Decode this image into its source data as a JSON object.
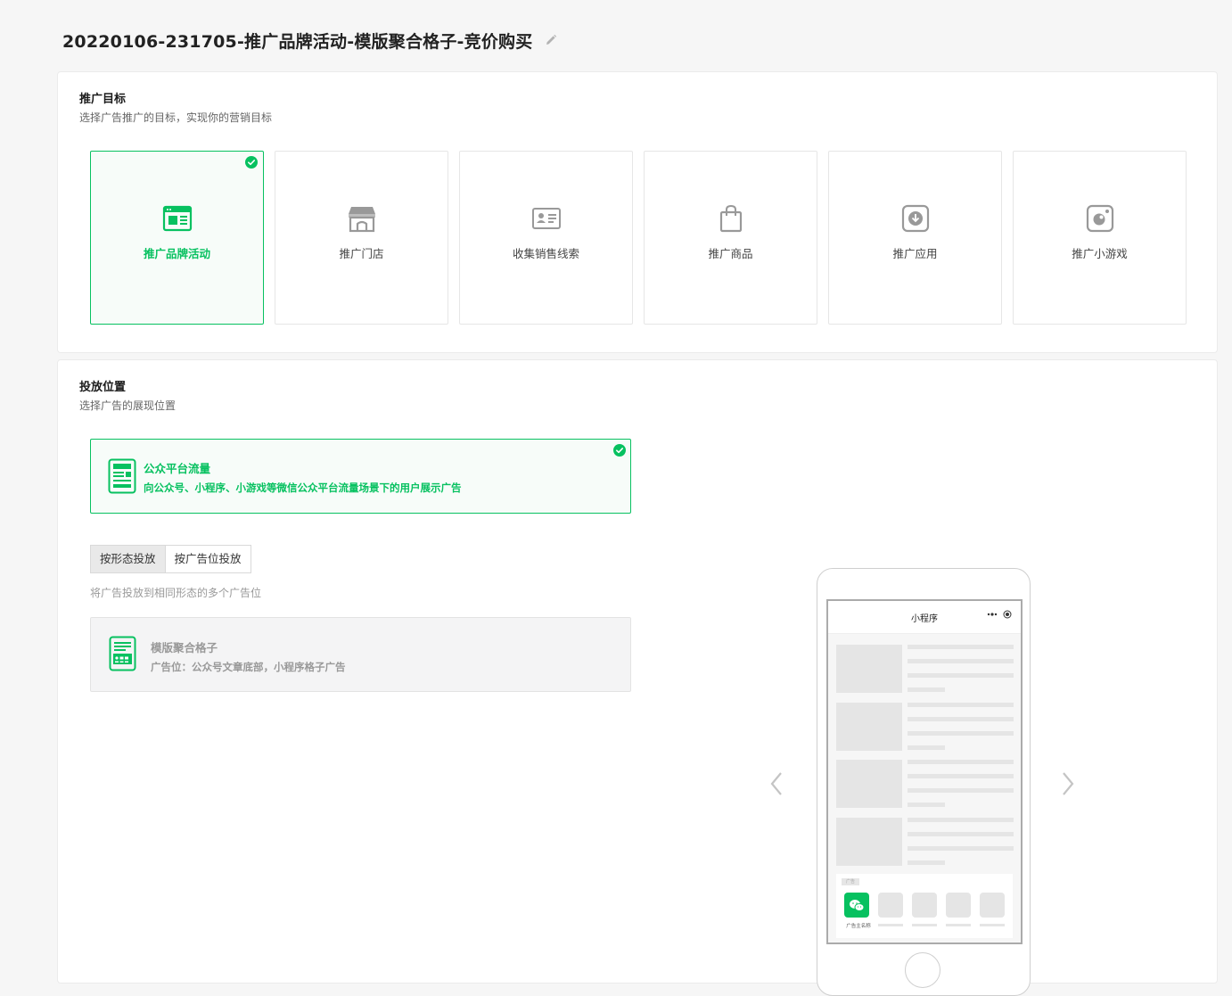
{
  "header": {
    "title": "20220106-231705-推广品牌活动-模版聚合格子-竞价购买",
    "edit_icon": "pencil-icon"
  },
  "goal_section": {
    "title": "推广目标",
    "description": "选择广告推广的目标，实现你的营销目标",
    "options": [
      {
        "label": "推广品牌活动",
        "icon": "brand-activity-icon",
        "selected": true
      },
      {
        "label": "推广门店",
        "icon": "store-icon",
        "selected": false
      },
      {
        "label": "收集销售线索",
        "icon": "contact-card-icon",
        "selected": false
      },
      {
        "label": "推广商品",
        "icon": "shopping-bag-icon",
        "selected": false
      },
      {
        "label": "推广应用",
        "icon": "download-app-icon",
        "selected": false
      },
      {
        "label": "推广小游戏",
        "icon": "mini-game-icon",
        "selected": false
      }
    ]
  },
  "placement_section": {
    "title": "投放位置",
    "description": "选择广告的展现位置",
    "selected_placement": {
      "title": "公众平台流量",
      "description": "向公众号、小程序、小游戏等微信公众平台流量场景下的用户展示广告",
      "icon": "article-icon"
    },
    "modes": [
      {
        "label": "按形态投放",
        "active": true
      },
      {
        "label": "按广告位投放",
        "active": false
      }
    ],
    "mode_hint": "将广告投放到相同形态的多个广告位",
    "format": {
      "title": "模版聚合格子",
      "description": "广告位：公众号文章底部，小程序格子广告",
      "icon": "grid-template-icon"
    }
  },
  "preview": {
    "miniapp_title": "小程序",
    "advertiser_label": "广告主名称",
    "ad_tag": "广告",
    "prev_icon": "chevron-left-icon",
    "next_icon": "chevron-right-icon"
  },
  "colors": {
    "accent": "#07c160",
    "background": "#f6f6f6",
    "card": "#ffffff"
  }
}
